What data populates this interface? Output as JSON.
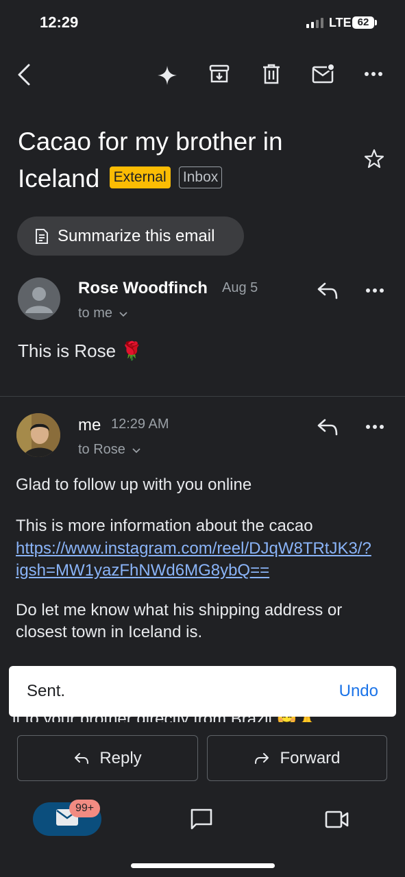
{
  "status_bar": {
    "time": "12:29",
    "network": "LTE",
    "battery": "62"
  },
  "toolbar": {
    "icons": [
      "back-icon",
      "sparkle-icon",
      "archive-icon",
      "delete-icon",
      "mark-unread-icon",
      "more-icon"
    ]
  },
  "subject": {
    "text": "Cacao for my brother in Iceland",
    "labels": [
      "External",
      "Inbox"
    ]
  },
  "summarize_label": "Summarize this email",
  "messages": [
    {
      "sender": "Rose Woodfinch",
      "date": "Aug 5",
      "recipient": "to me",
      "body": "This is Rose 🌹"
    },
    {
      "sender": "me",
      "date": "12:29 AM",
      "recipient": "to Rose",
      "body_line1": "Glad to follow up with you online",
      "body_line2": "This is more information about the cacao",
      "link_line1": "https://www.instagram.com/reel/DJqW8TRtJK3/?",
      "link_line2": "igsh=MW1yazFhNWd6MG8ybQ==",
      "body_line3": "Do let me know what his shipping address or",
      "body_line4": "closest town in Iceland is.",
      "body_partial": "it to your brother directly from Brazil 😊🙏"
    }
  ],
  "snackbar": {
    "text": "Sent.",
    "action": "Undo"
  },
  "actions": {
    "reply": "Reply",
    "forward": "Forward"
  },
  "bottom_nav": {
    "mail_badge": "99+"
  },
  "colors": {
    "background": "#202124",
    "accent": "#8ab4f8",
    "external_chip": "#fbbc04",
    "badge": "#f28b82"
  }
}
